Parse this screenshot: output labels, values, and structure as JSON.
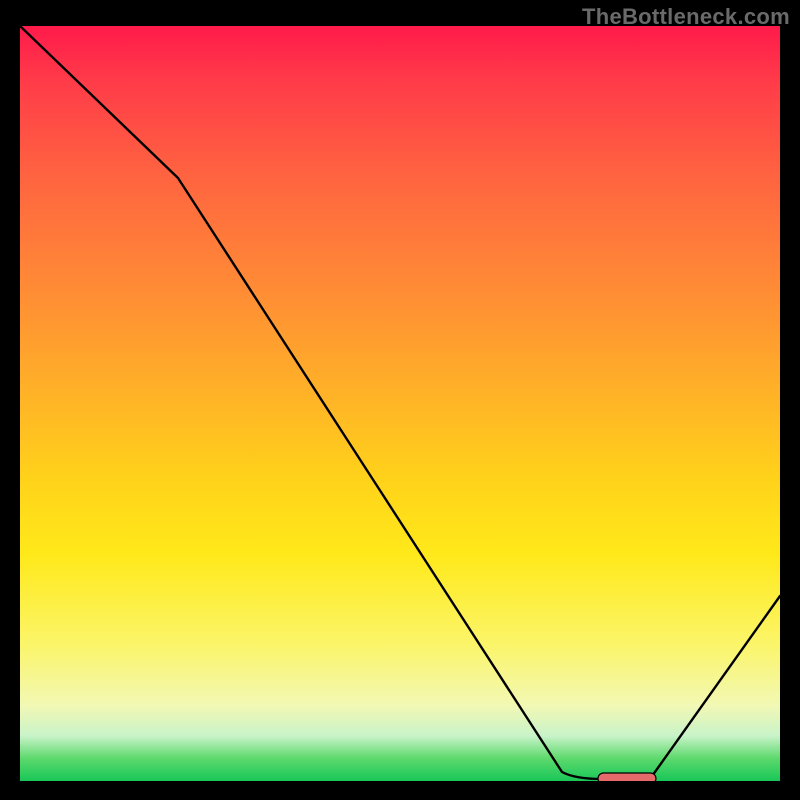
{
  "watermark": "TheBottleneck.com",
  "colors": {
    "curve": "#000000",
    "marker_fill": "#e76a6a",
    "marker_stroke": "#000000",
    "gradient_top": "#ff1a4a",
    "gradient_bottom": "#18c758"
  },
  "chart_data": {
    "type": "line",
    "title": "",
    "xlabel": "",
    "ylabel": "",
    "xlim": [
      0,
      100
    ],
    "ylim": [
      0,
      100
    ],
    "grid": false,
    "legend": false,
    "x": [
      0,
      20,
      72,
      77,
      83,
      100
    ],
    "values": [
      100,
      80,
      1,
      0,
      0,
      25
    ],
    "marker": {
      "x_start": 77,
      "x_end": 83,
      "y": 0
    },
    "notes": "Values read off relative vertical position (0 = bottom/green optimum, 100 = top/red). Curve descends from top-left, kinks around x≈20, reaches a flat minimum near x≈77–83 (highlighted segment), then rises to ≈25 at x=100."
  }
}
